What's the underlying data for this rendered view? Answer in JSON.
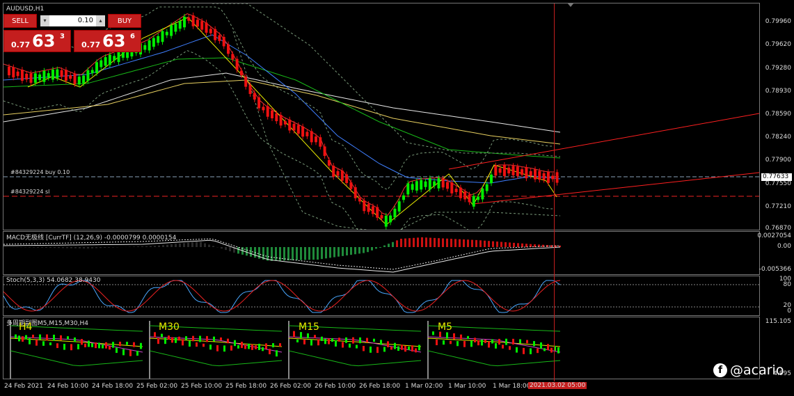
{
  "chart": {
    "symbol": "AUDUSD,H1",
    "price_levels": [
      "0.79960",
      "0.79620",
      "0.79280",
      "0.78930",
      "0.78590",
      "0.78240",
      "0.77900",
      "0.77550",
      "0.77210",
      "0.76870"
    ],
    "current_price": "0.77633",
    "orders": {
      "buy": "#84329224 buy 0.10",
      "sl": "#84329224 sl"
    }
  },
  "trade_panel": {
    "sell_label": "SELL",
    "buy_label": "BUY",
    "lot_value": "0.10",
    "sell_price": {
      "prefix": "0.77",
      "big": "63",
      "sup": "3"
    },
    "buy_price": {
      "prefix": "0.77",
      "big": "63",
      "sup": "6"
    }
  },
  "macd": {
    "title": "MACD无极线 [CurrTF] (12,26,9) -0.0000799 0.0000154",
    "levels": [
      "0.0027054",
      "0.00",
      "-0.005366"
    ]
  },
  "stoch": {
    "title": "Stoch(5,3,3) 54.0682 38.9430",
    "levels": [
      "100",
      "80",
      "20",
      "0"
    ]
  },
  "multi": {
    "title": "多周期副图M5,M15,M30,H4",
    "levels": [
      "115.105",
      "4.995"
    ],
    "timeframes": [
      "H4",
      "M30",
      "M15",
      "M5"
    ]
  },
  "time_axis": {
    "labels": [
      "24 Feb 2021",
      "24 Feb 10:00",
      "24 Feb 18:00",
      "25 Feb 02:00",
      "25 Feb 10:00",
      "25 Feb 18:00",
      "26 Feb 02:00",
      "26 Feb 10:00",
      "26 Feb 18:00",
      "1 Mar 02:00",
      "1 Mar 10:00",
      "1 Mar 18:00"
    ],
    "cursor_time": "2021.03.02 05:00"
  },
  "watermark": {
    "text": "@acario",
    "icon": "f"
  },
  "colors": {
    "bull": "#00ee00",
    "bear": "#ee1111",
    "ma_blue": "#3f7fff",
    "ma_green": "#18b818",
    "ma_white": "#e8e8e8",
    "ma_yellow": "#e8d060",
    "channel": "#ff2020"
  }
}
